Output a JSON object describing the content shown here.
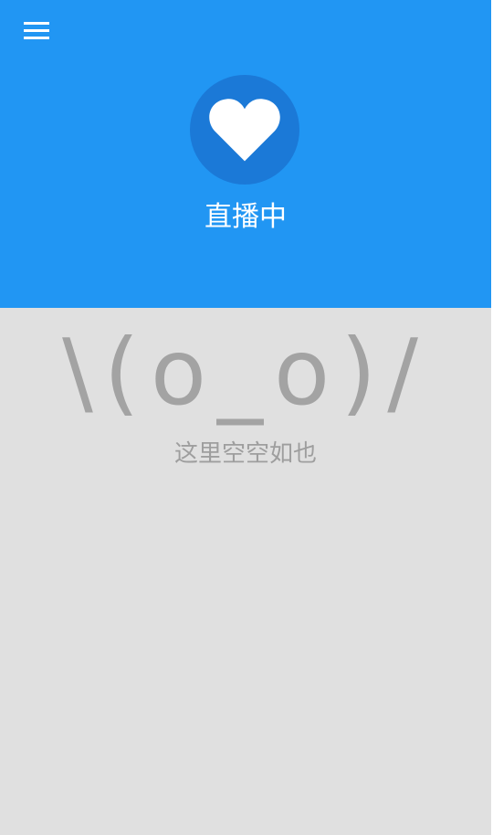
{
  "header": {
    "menu_icon": "hamburger-menu-icon",
    "avatar_icon": "heart-icon",
    "title": "直播中",
    "background_color": "#2196F3",
    "avatar_color": "#1B79D7"
  },
  "empty_state": {
    "emoticon": "\\(o_o)/",
    "message": "这里空空如也",
    "background_color": "#E0E0E0",
    "text_color": "#A3A3A3"
  }
}
